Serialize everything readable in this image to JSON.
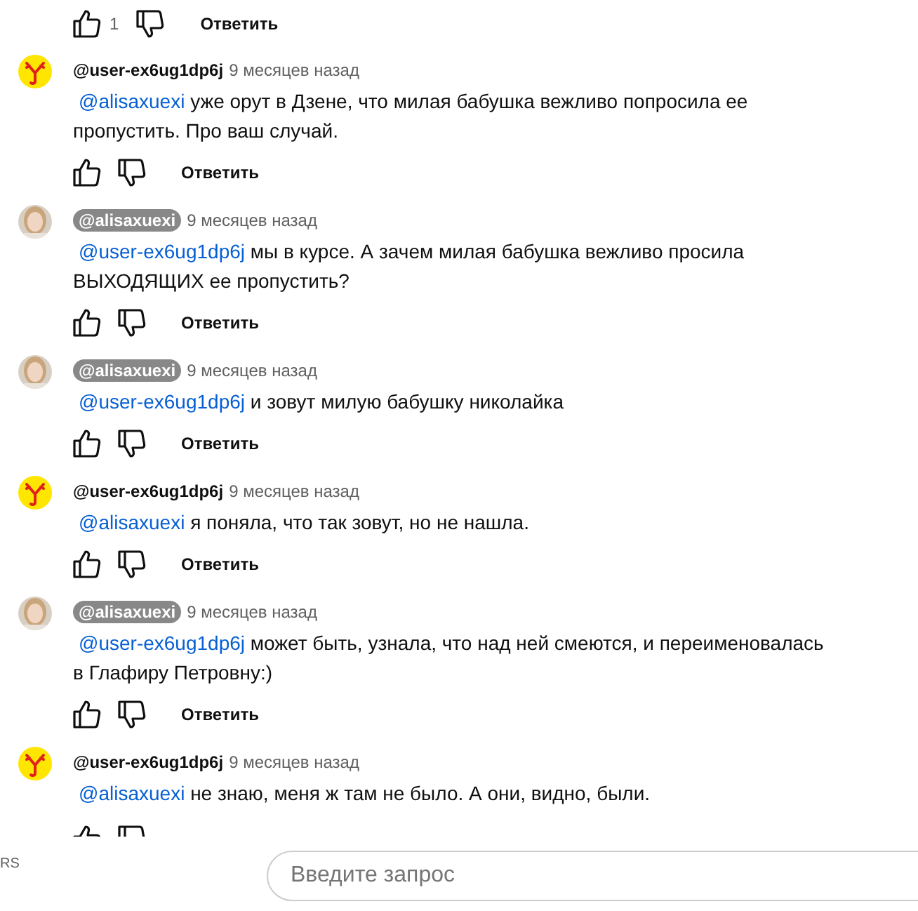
{
  "parent_actions": {
    "like_count": "1",
    "reply": "Ответить"
  },
  "comments": [
    {
      "avatar": {
        "kind": "logo"
      },
      "author": "@user-ex6ug1dp6j",
      "owner": false,
      "time": "9 месяцев назад",
      "mention": "@alisaxuexi",
      "text": "уже орут в Дзене, что милая бабушка вежливо попросила ее пропустить. Про ваш случай.",
      "reply": "Ответить"
    },
    {
      "author": "@alisaxuexi",
      "owner": true,
      "time": "9 месяцев назад",
      "mention": "@user-ex6ug1dp6j",
      "text": "мы в курсе. А зачем милая бабушка вежливо просила ВЫХОДЯЩИХ ее пропустить?",
      "reply": "Ответить"
    },
    {
      "author": "@alisaxuexi",
      "owner": true,
      "time": "9 месяцев назад",
      "mention": "@user-ex6ug1dp6j",
      "text": "и зовут милую бабушку николайка",
      "reply": "Ответить"
    },
    {
      "avatar": {
        "kind": "logo"
      },
      "author": "@user-ex6ug1dp6j",
      "owner": false,
      "time": "9 месяцев назад",
      "mention": "@alisaxuexi",
      "text": "я поняла, что так зовут, но не нашла.",
      "reply": "Ответить"
    },
    {
      "author": "@alisaxuexi",
      "owner": true,
      "time": "9 месяцев назад",
      "mention": "@user-ex6ug1dp6j",
      "text": "может быть, узнала, что над ней смеются, и переименовалась в Глафиру Петровну:)",
      "reply": "Ответить"
    },
    {
      "avatar": {
        "kind": "logo"
      },
      "author": "@user-ex6ug1dp6j",
      "owner": false,
      "time": "9 месяцев назад",
      "mention": "@alisaxuexi",
      "text": "не знаю, меня ж там не было. А они, видно, были."
    }
  ],
  "bottom_bar": {
    "corner_text": "RS",
    "search": {
      "placeholder": "Введите запрос"
    }
  }
}
